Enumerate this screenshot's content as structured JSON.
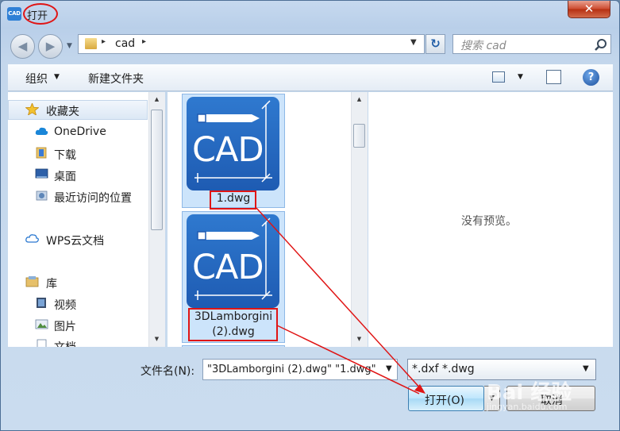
{
  "window": {
    "title": "打开",
    "app_icon": "CAD",
    "close_symbol": "✕"
  },
  "nav": {
    "back_symbol": "◀",
    "forward_symbol": "▶",
    "history_symbol": "▼"
  },
  "address": {
    "crumb": "cad",
    "separator": "▸",
    "dropdown_symbol": "▼"
  },
  "refresh_symbol": "↻",
  "search": {
    "placeholder": "搜索 cad"
  },
  "toolbar": {
    "organize": "组织",
    "new_folder": "新建文件夹",
    "dropdown_symbol": "▼",
    "help": "?"
  },
  "sidebar": {
    "favorites": "收藏夹",
    "onedrive": "OneDrive",
    "downloads": "下载",
    "desktop": "桌面",
    "recent": "最近访问的位置",
    "wps_cloud": "WPS云文档",
    "libraries": "库",
    "videos": "视频",
    "pictures": "图片",
    "documents": "文档"
  },
  "files": [
    {
      "name": "1.dwg",
      "icon_text": "CAD"
    },
    {
      "name_line1": "3DLamborgini",
      "name_line2": "(2).dwg",
      "icon_text": "CAD"
    }
  ],
  "preview": {
    "text": "没有预览。"
  },
  "bottom": {
    "filename_label": "文件名(N):",
    "filename_value": "\"3DLamborgini (2).dwg\" \"1.dwg\"",
    "filetype": "*.dxf *.dwg",
    "open_label": "打开(O)",
    "cancel_label": "取消"
  },
  "watermark": {
    "main": "Bai 经验",
    "sub": "jingyan.baidu.com"
  },
  "colors": {
    "annotation": "#e01515",
    "accent": "#1e5bb2",
    "selection": "#cce4fb"
  }
}
